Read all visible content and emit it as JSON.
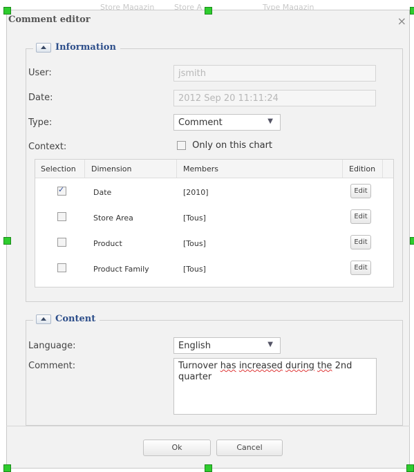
{
  "window": {
    "title": "Comment editor",
    "close_icon": "×"
  },
  "background_tabs": [
    "Store Magazin",
    "Store A",
    "Type Magazin"
  ],
  "information": {
    "legend": "Information",
    "user_label": "User:",
    "user_value": "jsmith",
    "date_label": "Date:",
    "date_value": "2012 Sep 20 11:11:24",
    "type_label": "Type:",
    "type_value": "Comment",
    "context_label": "Context:",
    "only_chart_label": "Only on this chart",
    "only_chart_checked": false
  },
  "grid": {
    "columns": [
      "Selection",
      "Dimension",
      "Members",
      "Edition"
    ],
    "rows": [
      {
        "selected": true,
        "dimension": "Date",
        "members": "[2010]",
        "edit": "Edit"
      },
      {
        "selected": false,
        "dimension": "Store Area",
        "members": "[Tous]",
        "edit": "Edit"
      },
      {
        "selected": false,
        "dimension": "Product",
        "members": "[Tous]",
        "edit": "Edit"
      },
      {
        "selected": false,
        "dimension": "Product Family",
        "members": "[Tous]",
        "edit": "Edit"
      }
    ]
  },
  "content": {
    "legend": "Content",
    "language_label": "Language:",
    "language_value": "English",
    "comment_label": "Comment:",
    "comment_plain_1": "Turnover ",
    "comment_err_1": "has",
    "comment_plain_2": " ",
    "comment_err_2": "increased",
    "comment_plain_3": " ",
    "comment_err_3": "during",
    "comment_plain_4": " ",
    "comment_err_4": "the",
    "comment_plain_5": " 2nd quarter"
  },
  "buttons": {
    "ok": "Ok",
    "cancel": "Cancel"
  },
  "colors": {
    "accent": "#2d4e8a",
    "handle": "#2ecc2e",
    "dialog_bg": "#f2f2f2"
  }
}
